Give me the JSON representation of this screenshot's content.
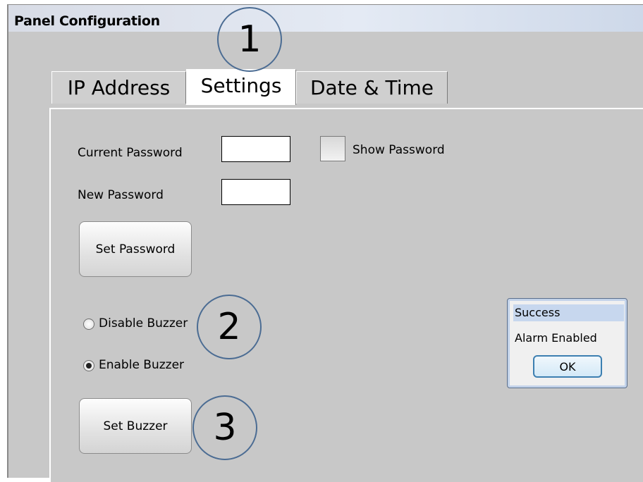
{
  "window": {
    "title": "Panel Configuration"
  },
  "tabs": [
    {
      "label": "IP Address",
      "active": false
    },
    {
      "label": "Settings",
      "active": true
    },
    {
      "label": "Date & Time",
      "active": false
    }
  ],
  "settings": {
    "current_password_label": "Current Password",
    "current_password_value": "",
    "new_password_label": "New Password",
    "new_password_value": "",
    "show_password_label": "Show Password",
    "show_password_checked": false,
    "set_password_button": "Set Password",
    "disable_buzzer_label": "Disable Buzzer",
    "enable_buzzer_label": "Enable Buzzer",
    "buzzer_selected": "Enable Buzzer",
    "set_buzzer_button": "Set Buzzer"
  },
  "dialog": {
    "title": "Success",
    "message": "Alarm Enabled",
    "ok_button": "OK"
  },
  "callouts": [
    "1",
    "2",
    "3"
  ],
  "colors": {
    "window_bg": "#c8c8c8",
    "callout_border": "#4b6c93",
    "dialog_title_bg": "#c7d7ee",
    "ok_border": "#3c7fb1"
  }
}
